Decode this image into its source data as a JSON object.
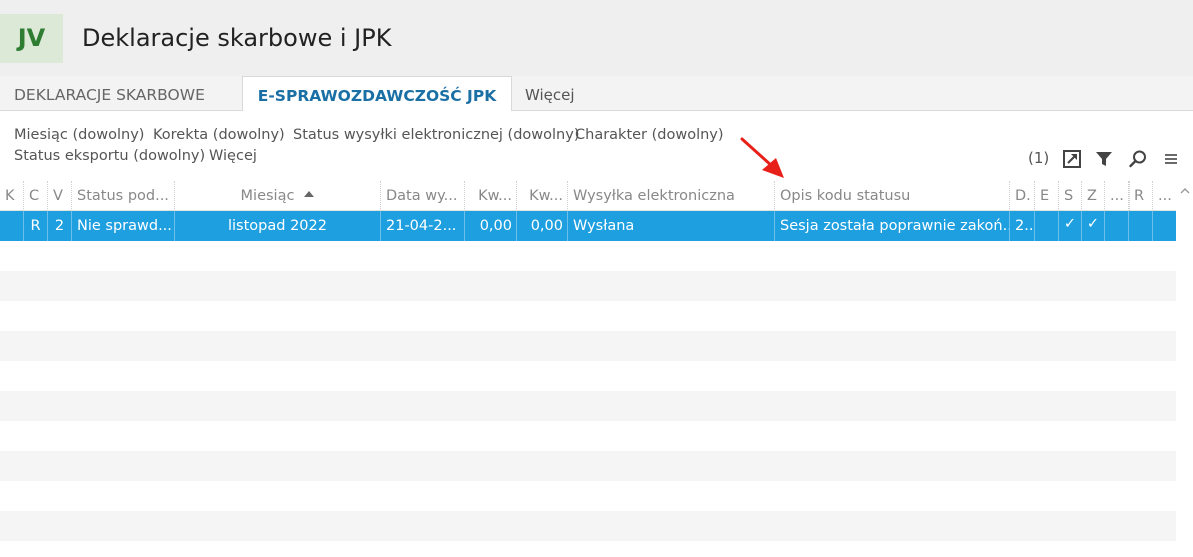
{
  "app": {
    "badge": "JV",
    "title": "Deklaracje skarbowe i JPK"
  },
  "tabs": [
    {
      "label": "DEKLARACJE SKARBOWE",
      "active": false
    },
    {
      "label": "E-SPRAWOZDAWCZOŚĆ JPK",
      "active": true
    },
    {
      "label": "Więcej",
      "active": false
    }
  ],
  "filters": [
    "Miesiąc (dowolny)",
    "Korekta (dowolny)",
    "Status wysyłki elektronicznej (dowolny)",
    "Charakter (dowolny)",
    "Status eksportu (dowolny)",
    "Więcej"
  ],
  "toolbar": {
    "count": "(1)",
    "icons": [
      "export-icon",
      "filter-icon",
      "search-icon",
      "menu-icon"
    ]
  },
  "grid": {
    "columns": [
      "K",
      "C",
      "V",
      "Status pod...",
      "Miesiąc",
      "Data wy...",
      "Kw...",
      "Kw...",
      "Wysyłka elektroniczna",
      "Opis kodu statusu",
      "D.",
      "E",
      "S",
      "Z",
      "...",
      "",
      "R",
      "..."
    ],
    "sorted_column": "Miesiąc",
    "rows": [
      {
        "k": "",
        "c": "R",
        "v": "2",
        "status": "Nie sprawd...",
        "miesiac": "listopad 2022",
        "data": "21-04-2...",
        "kw1": "0,00",
        "kw2": "0,00",
        "wysylka": "Wysłana",
        "opis": "Sesja została poprawnie zakoń...",
        "d": "2..",
        "e": "",
        "s": "✓",
        "z": "✓"
      }
    ]
  },
  "colors": {
    "selection": "#1e9fe0",
    "active_tab": "#1a6fa5",
    "badge_text": "#2e7d32",
    "arrow": "#e8201a"
  }
}
